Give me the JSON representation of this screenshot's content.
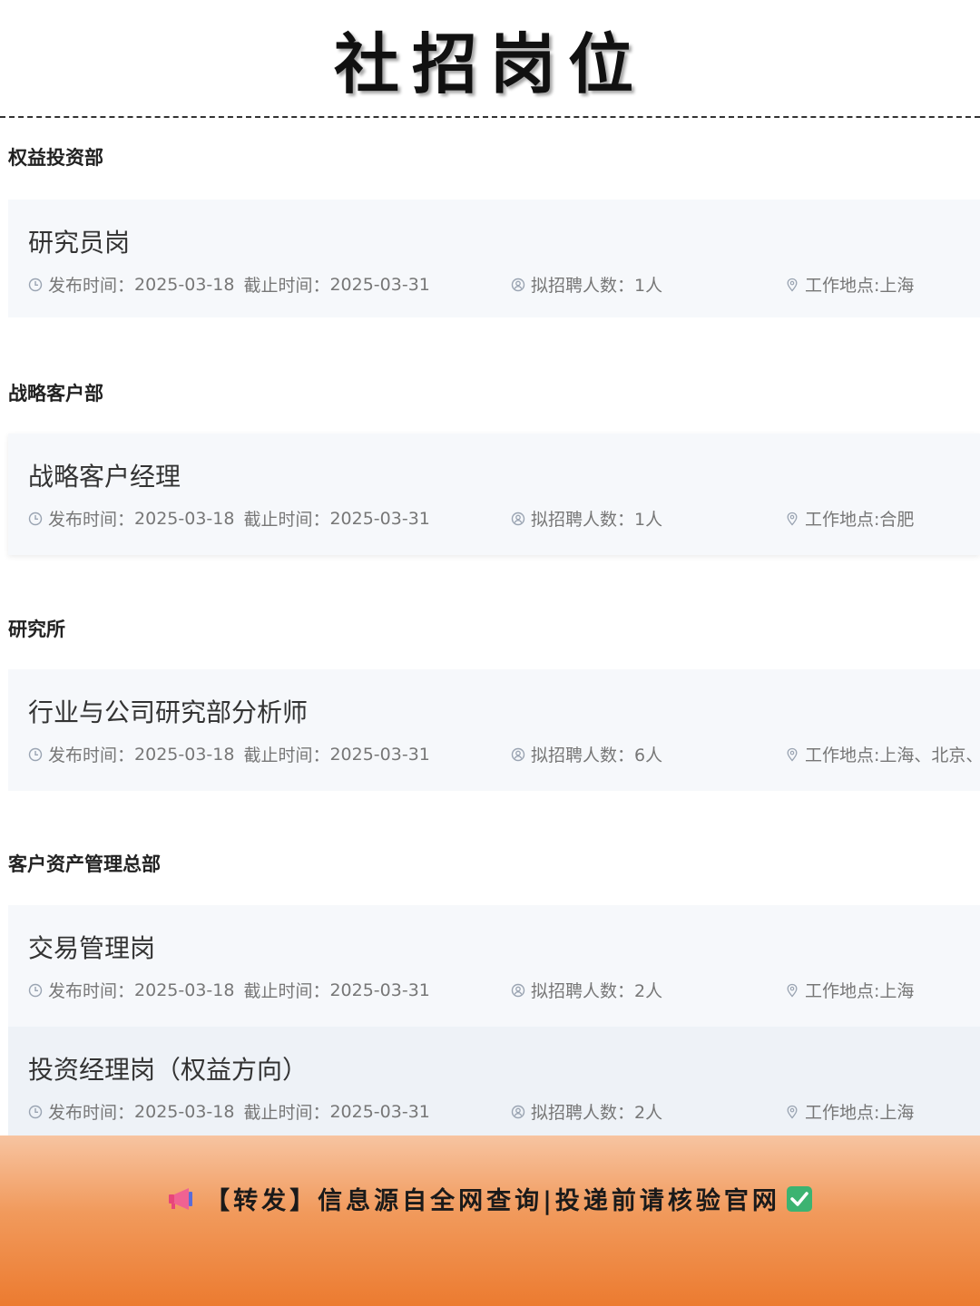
{
  "header": {
    "title": "社招岗位"
  },
  "labels": {
    "publish": "发布时间：",
    "deadline": "截止时间：",
    "count": "拟招聘人数：",
    "location": "工作地点:"
  },
  "sections": [
    {
      "name": "权益投资部",
      "jobs": [
        {
          "title": "研究员岗",
          "publish_date": "2025-03-18",
          "deadline": "2025-03-31",
          "count": "1人",
          "location": "上海"
        }
      ]
    },
    {
      "name": "战略客户部",
      "jobs": [
        {
          "title": "战略客户经理",
          "publish_date": "2025-03-18",
          "deadline": "2025-03-31",
          "count": "1人",
          "location": "合肥"
        }
      ]
    },
    {
      "name": "研究所",
      "jobs": [
        {
          "title": "行业与公司研究部分析师",
          "publish_date": "2025-03-18",
          "deadline": "2025-03-31",
          "count": "6人",
          "location": "上海、北京、合肥"
        }
      ]
    },
    {
      "name": "客户资产管理总部",
      "jobs": [
        {
          "title": "交易管理岗",
          "publish_date": "2025-03-18",
          "deadline": "2025-03-31",
          "count": "2人",
          "location": "上海"
        },
        {
          "title": "投资经理岗（权益方向）",
          "publish_date": "2025-03-18",
          "deadline": "2025-03-31",
          "count": "2人",
          "location": "上海"
        }
      ]
    }
  ],
  "footer": {
    "text": "【转发】信息源自全网查询|投递前请核验官网"
  },
  "colors": {
    "icon": "#9aa4b2",
    "footer_start": "#f7c4a1",
    "footer_end": "#ec7b30"
  }
}
